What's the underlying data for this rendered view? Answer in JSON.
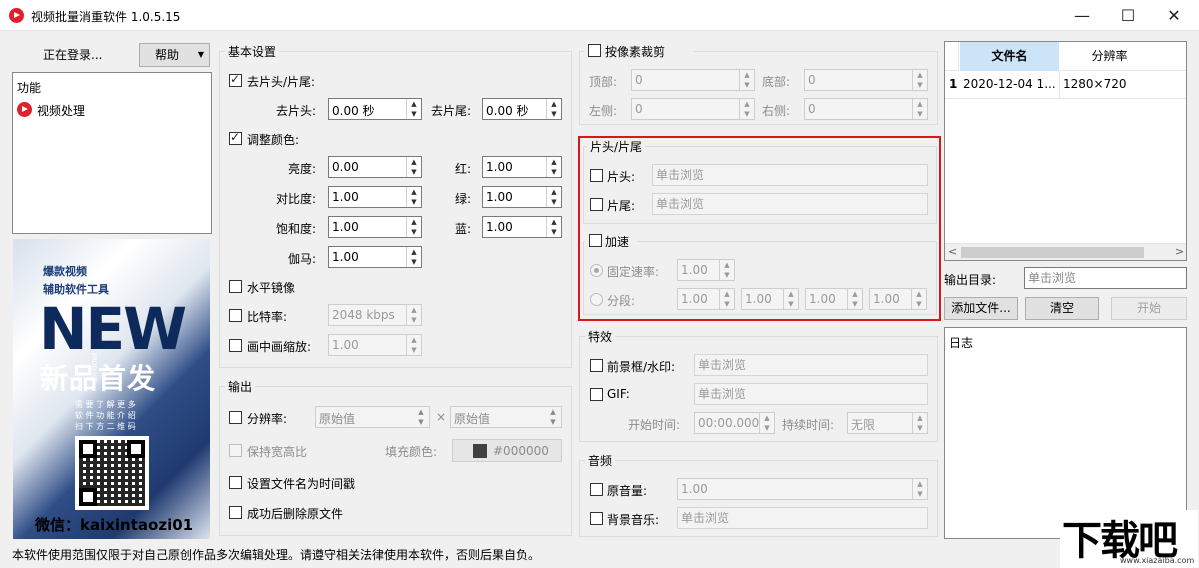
{
  "window": {
    "title": "视频批量消重软件 1.0.5.15",
    "minimize": "—",
    "maximize": "☐",
    "close": "✕"
  },
  "left": {
    "status": "正在登录...",
    "help_button": "帮助",
    "help_arrow": "▼",
    "func_title": "功能",
    "func_item": "视频处理",
    "banner": {
      "line1": "爆款视频",
      "line2": "辅助软件工具",
      "big": "NEW",
      "sub": "新品首发",
      "product": "PRODUCT",
      "small1": "需 要 了 解 更 多",
      "small2": "软 件 功 能 介 绍",
      "small3": "扫 下 方 二 维 码",
      "wechat": "微信：kaixintaozi01"
    }
  },
  "basic": {
    "title": "基本设置",
    "trim_label": "去片头/片尾:",
    "head_label": "去片头:",
    "head_value": "0.00 秒",
    "tail_label": "去片尾:",
    "tail_value": "0.00 秒",
    "color_label": "调整颜色:",
    "brightness_label": "亮度:",
    "brightness": "0.00",
    "red_label": "红:",
    "red": "1.00",
    "contrast_label": "对比度:",
    "contrast": "1.00",
    "green_label": "绿:",
    "green": "1.00",
    "saturation_label": "饱和度:",
    "saturation": "1.00",
    "blue_label": "蓝:",
    "blue": "1.00",
    "gamma_label": "伽马:",
    "gamma": "1.00",
    "mirror_label": "水平镜像",
    "bitrate_label": "比特率:",
    "bitrate": "2048 kbps",
    "pip_label": "画中画缩放:",
    "pip": "1.00"
  },
  "output": {
    "title": "输出",
    "resolution_label": "分辨率:",
    "res_w": "原始值",
    "times": "×",
    "res_h": "原始值",
    "keep_ratio": "保持宽高比",
    "fill_label": "填充颜色:",
    "fill_color": "#000000",
    "fill_swatch": "#404040",
    "timestamp_name": "设置文件名为时间戳",
    "delete_source": "成功后删除原文件"
  },
  "crop": {
    "title": "按像素裁剪",
    "top_label": "顶部:",
    "top": "0",
    "bottom_label": "底部:",
    "bottom": "0",
    "left_label": "左侧:",
    "left": "0",
    "right_label": "右侧:",
    "right": "0"
  },
  "headtail": {
    "title": "片头/片尾",
    "head_label": "片头:",
    "tail_label": "片尾:",
    "placeholder": "单击浏览",
    "highlight_color": "#d9161c"
  },
  "speed": {
    "title": "加速",
    "fixed_label": "固定速率:",
    "fixed_value": "1.00",
    "segment_label": "分段:",
    "seg1": "1.00",
    "seg2": "1.00",
    "seg3": "1.00",
    "seg4": "1.00"
  },
  "effects": {
    "title": "特效",
    "frame_label": "前景框/水印:",
    "gif_label": "GIF:",
    "placeholder": "单击浏览",
    "start_label": "开始时间:",
    "start_value": "00:00.000",
    "duration_label": "持续时间:",
    "duration_value": "无限"
  },
  "audio": {
    "title": "音频",
    "original_label": "原音量:",
    "original_value": "1.00",
    "bgm_label": "背景音乐:",
    "placeholder": "单击浏览"
  },
  "files": {
    "columns": [
      "文件名",
      "分辨率"
    ],
    "rows": [
      {
        "index": "1",
        "name": "2020-12-04 1...",
        "resolution": "1280×720"
      }
    ],
    "scroll_left": "<",
    "scroll_right": ">"
  },
  "right": {
    "output_dir_label": "输出目录:",
    "output_dir_placeholder": "单击浏览",
    "add_button": "添加文件...",
    "clear_button": "清空",
    "start_button": "开始",
    "log_label": "日志"
  },
  "footer": {
    "notice": "本软件使用范围仅限于对自己原创作品多次编辑处理。请遵守相关法律使用本软件，否则后果自负。"
  },
  "watermark": {
    "text": "下载吧",
    "url": "www.xiazaiba.com"
  }
}
